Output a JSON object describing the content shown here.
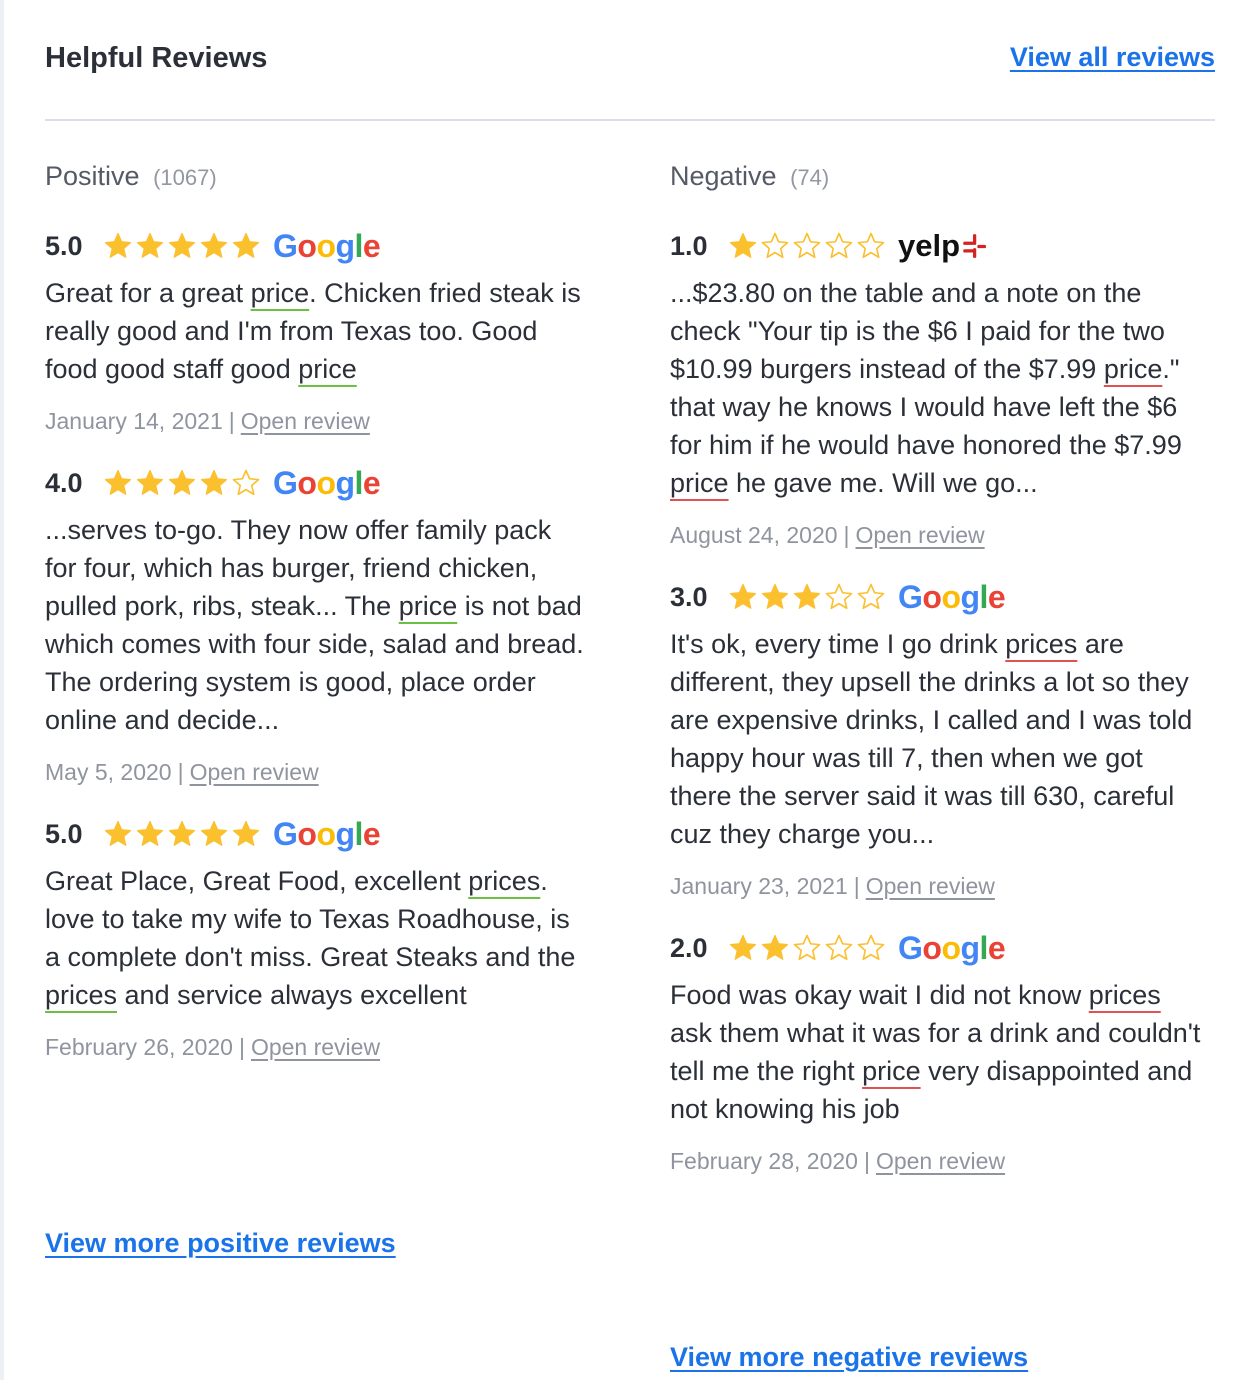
{
  "header": {
    "title": "Helpful Reviews",
    "view_all": "View all reviews"
  },
  "positive": {
    "label": "Positive",
    "count": "(1067)",
    "more": "View more positive reviews",
    "reviews": [
      {
        "score": "5.0",
        "stars": 5,
        "source": "Google",
        "segments": [
          {
            "t": "Great for a great "
          },
          {
            "t": "price",
            "hl": true
          },
          {
            "t": ". Chicken fried steak is really good and I'm from Texas too. Good food good staff good "
          },
          {
            "t": "price",
            "hl": true
          }
        ],
        "date": "January 14, 2021",
        "open": "Open review"
      },
      {
        "score": "4.0",
        "stars": 4,
        "source": "Google",
        "segments": [
          {
            "t": "...serves to-go. They now offer family pack for four, which has burger, friend chicken, pulled pork, ribs, steak... The "
          },
          {
            "t": "price",
            "hl": true
          },
          {
            "t": " is not bad which comes with four side, salad and bread. The ordering system is good, place order online and decide..."
          }
        ],
        "date": "May 5, 2020",
        "open": "Open review"
      },
      {
        "score": "5.0",
        "stars": 5,
        "source": "Google",
        "segments": [
          {
            "t": "Great Place, Great Food, excellent "
          },
          {
            "t": "prices",
            "hl": true
          },
          {
            "t": ". love to take my wife to Texas Roadhouse, is a complete don't miss. Great Steaks and the "
          },
          {
            "t": "prices",
            "hl": true
          },
          {
            "t": " and service always excellent"
          }
        ],
        "date": "February 26, 2020",
        "open": "Open review"
      }
    ]
  },
  "negative": {
    "label": "Negative",
    "count": "(74)",
    "more": "View more negative reviews",
    "reviews": [
      {
        "score": "1.0",
        "stars": 1,
        "source": "yelp",
        "segments": [
          {
            "t": "...$23.80 on the table and a note on the check \"Your tip is the $6 I paid for the two $10.99 burgers instead of the $7.99 "
          },
          {
            "t": "price",
            "hl": true
          },
          {
            "t": ".\" that way he knows I would have left the $6 for him if he would have honored the $7.99 "
          },
          {
            "t": "price",
            "hl": true
          },
          {
            "t": " he gave me. Will we go..."
          }
        ],
        "date": "August 24, 2020",
        "open": "Open review"
      },
      {
        "score": "3.0",
        "stars": 3,
        "source": "Google",
        "segments": [
          {
            "t": "It's ok, every time I go drink "
          },
          {
            "t": "prices",
            "hl": true
          },
          {
            "t": " are different, they upsell the drinks a lot so they are expensive drinks, I called and I was told happy hour was till 7, then when we got there the server said it was till 630, careful cuz they charge you..."
          }
        ],
        "date": "January 23, 2021",
        "open": "Open review"
      },
      {
        "score": "2.0",
        "stars": 2,
        "source": "Google",
        "segments": [
          {
            "t": "Food was okay wait I did not know "
          },
          {
            "t": "prices",
            "hl": true
          },
          {
            "t": " ask them what it was for a drink and couldn't tell me the right "
          },
          {
            "t": "price",
            "hl": true
          },
          {
            "t": " very disappointed and not knowing his job"
          }
        ],
        "date": "February 28, 2020",
        "open": "Open review"
      }
    ]
  },
  "colors": {
    "star_fill": "#fbc02d",
    "link": "#1a73e8",
    "pos_underline": "#6bbf45",
    "neg_underline": "#e05252",
    "google_blue": "#4285f4",
    "google_red": "#ea4335",
    "google_yellow": "#fbbc05",
    "google_green": "#34a853",
    "yelp_red": "#d32323"
  },
  "icons": {
    "star_full": "star-icon",
    "star_empty": "star-outline-icon",
    "google": "google-logo",
    "yelp": "yelp-logo"
  }
}
